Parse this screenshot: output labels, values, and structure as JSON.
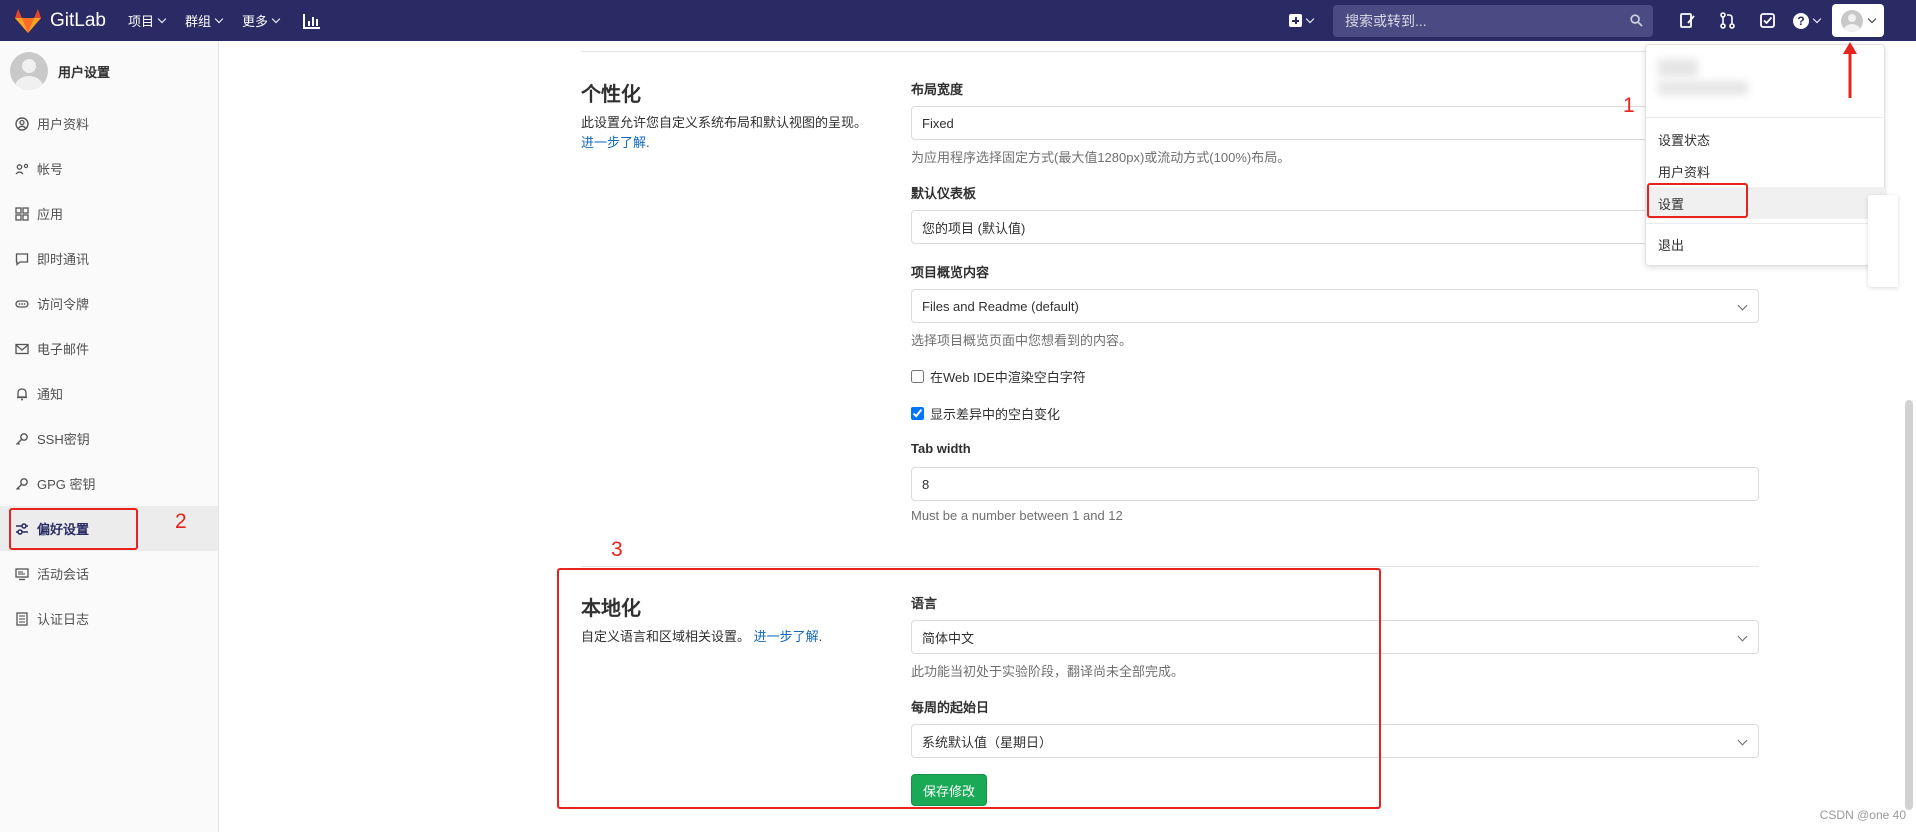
{
  "navbar": {
    "brand": "GitLab",
    "menu": [
      {
        "label": "项目"
      },
      {
        "label": "群组"
      },
      {
        "label": "更多"
      }
    ],
    "search_placeholder": "搜索或转到...",
    "help": "?"
  },
  "sidebar": {
    "title": "用户设置",
    "items": [
      {
        "label": "用户资料",
        "icon": "user-icon"
      },
      {
        "label": "帐号",
        "icon": "account-icon"
      },
      {
        "label": "应用",
        "icon": "applications-icon"
      },
      {
        "label": "即时通讯",
        "icon": "chat-icon"
      },
      {
        "label": "访问令牌",
        "icon": "token-icon"
      },
      {
        "label": "电子邮件",
        "icon": "mail-icon"
      },
      {
        "label": "通知",
        "icon": "bell-icon"
      },
      {
        "label": "SSH密钥",
        "icon": "key-icon"
      },
      {
        "label": "GPG 密钥",
        "icon": "key-icon"
      },
      {
        "label": "偏好设置",
        "icon": "preferences-icon",
        "active": true
      },
      {
        "label": "活动会话",
        "icon": "monitor-icon"
      },
      {
        "label": "认证日志",
        "icon": "log-icon"
      }
    ]
  },
  "personalization": {
    "title": "个性化",
    "description": "此设置允许您自定义系统布局和默认视图的呈现。",
    "learn_more": "进一步了解",
    "layout_width": {
      "label": "布局宽度",
      "value": "Fixed",
      "help": "为应用程序选择固定方式(最大值1280px)或流动方式(100%)布局。"
    },
    "default_dashboard": {
      "label": "默认仪表板",
      "value": "您的项目 (默认值)"
    },
    "project_overview": {
      "label": "项目概览内容",
      "value": "Files and Readme (default)",
      "help": "选择项目概览页面中您想看到的内容。"
    },
    "render_whitespace": {
      "label": "在Web IDE中渲染空白字符",
      "checked": false
    },
    "show_whitespace_diff": {
      "label": "显示差异中的空白变化",
      "checked": true
    },
    "tab_width": {
      "label": "Tab width",
      "value": "8",
      "help": "Must be a number between 1 and 12"
    }
  },
  "localization": {
    "title": "本地化",
    "description": "自定义语言和区域相关设置。",
    "learn_more": "进一步了解",
    "language": {
      "label": "语言",
      "value": "简体中文",
      "help": "此功能当初处于实验阶段，翻译尚未全部完成。"
    },
    "first_day": {
      "label": "每周的起始日",
      "value": "系统默认值（星期日）"
    },
    "save_label": "保存修改"
  },
  "user_dropdown": {
    "items": [
      {
        "label": "设置状态"
      },
      {
        "label": "用户资料"
      },
      {
        "label": "设置"
      },
      {
        "label": "退出"
      }
    ]
  },
  "annotations": {
    "num1": "1",
    "num2": "2",
    "num3": "3",
    "color": "#e8231d"
  },
  "watermark": "CSDN @one 40",
  "colors": {
    "navbar": "#2a2b65",
    "link": "#1068bf",
    "save_button": "#1aaa55"
  }
}
